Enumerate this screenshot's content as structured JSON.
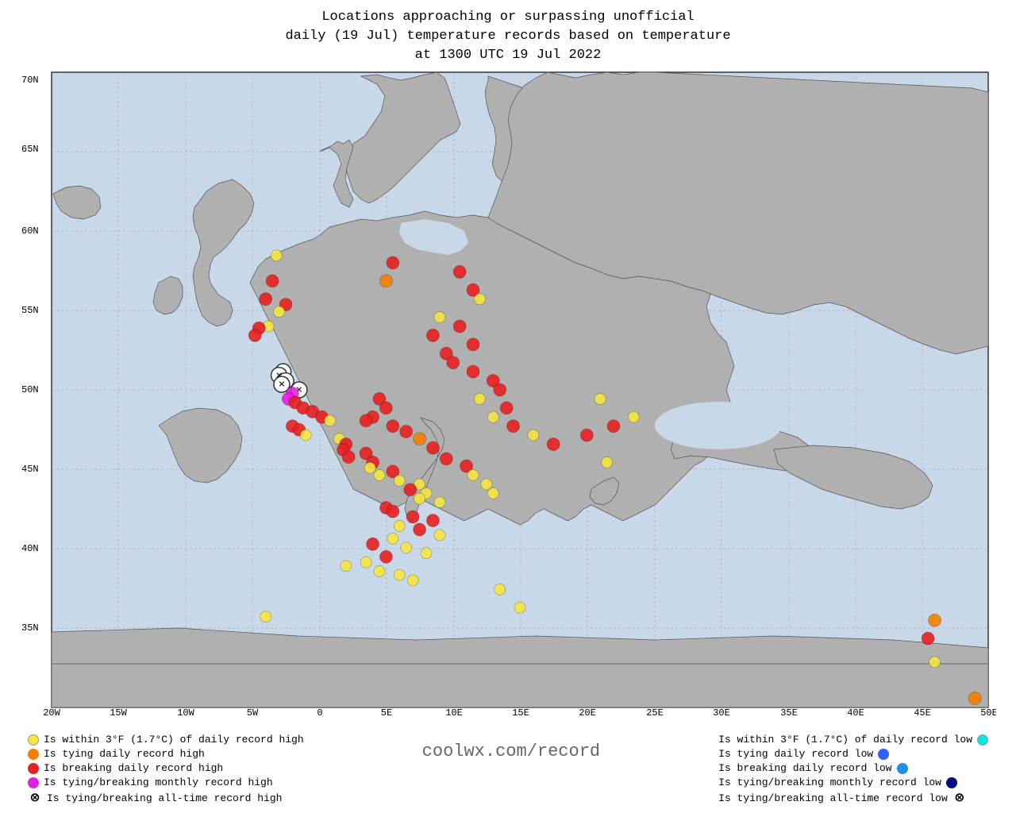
{
  "title": {
    "line1": "Locations approaching or surpassing unofficial",
    "line2": "daily (19 Jul) temperature records based on temperature",
    "line3": "at 1300 UTC 19 Jul 2022"
  },
  "legend": {
    "left": [
      {
        "color": "#f5e642",
        "label": "Is within 3°F (1.7°C) of daily record high",
        "type": "dot"
      },
      {
        "color": "#f58000",
        "label": "Is tying daily record high",
        "type": "dot"
      },
      {
        "color": "#e82020",
        "label": "Is breaking daily record high",
        "type": "dot"
      },
      {
        "color": "#e020e0",
        "label": "Is tying/breaking monthly record high",
        "type": "dot"
      },
      {
        "color": "#000",
        "label": "Is tying/breaking all-time record high",
        "type": "cross"
      }
    ],
    "right": [
      {
        "color": "#00e8e8",
        "label": "Is within 3°F (1.7°C) of daily record low",
        "type": "dot"
      },
      {
        "color": "#3060ff",
        "label": "Is tying daily record low",
        "type": "dot"
      },
      {
        "color": "#2090e0",
        "label": "Is breaking daily record low",
        "type": "dot"
      },
      {
        "color": "#001080",
        "label": "Is tying/breaking monthly record low",
        "type": "dot"
      },
      {
        "color": "#000",
        "label": "Is tying/breaking all-time record low",
        "type": "cross"
      }
    ],
    "center_text": "coolwx.com/record"
  },
  "map": {
    "lat_labels": [
      "70N",
      "65N",
      "60N",
      "55N",
      "50N",
      "45N",
      "40N",
      "35N"
    ],
    "lon_labels": [
      "20W",
      "15W",
      "10W",
      "5W",
      "0",
      "5E",
      "10E",
      "15E",
      "20E",
      "25E",
      "30E",
      "35E",
      "40E",
      "45E",
      "50E"
    ]
  },
  "data_points": [
    {
      "lat": 59.9,
      "lon": -3.2,
      "color": "#f5e642",
      "r": 7
    },
    {
      "lat": 58.5,
      "lon": -3.5,
      "color": "#e82020",
      "r": 8
    },
    {
      "lat": 57.5,
      "lon": -4.0,
      "color": "#e82020",
      "r": 8
    },
    {
      "lat": 57.2,
      "lon": -2.5,
      "color": "#e82020",
      "r": 8
    },
    {
      "lat": 56.8,
      "lon": -3.0,
      "color": "#f5e642",
      "r": 7
    },
    {
      "lat": 56.0,
      "lon": -3.8,
      "color": "#f5e642",
      "r": 7
    },
    {
      "lat": 55.9,
      "lon": -4.5,
      "color": "#e82020",
      "r": 8
    },
    {
      "lat": 55.5,
      "lon": -4.8,
      "color": "#e82020",
      "r": 8
    },
    {
      "lat": 53.5,
      "lon": -2.7,
      "color": "#000",
      "r": 9,
      "cross": true
    },
    {
      "lat": 53.3,
      "lon": -3.0,
      "color": "#000",
      "r": 9,
      "cross": true
    },
    {
      "lat": 53.0,
      "lon": -2.5,
      "color": "#000",
      "r": 9,
      "cross": true
    },
    {
      "lat": 52.8,
      "lon": -2.8,
      "color": "#000",
      "r": 9,
      "cross": true
    },
    {
      "lat": 52.5,
      "lon": -1.5,
      "color": "#000",
      "r": 9,
      "cross": true
    },
    {
      "lat": 52.3,
      "lon": -2.0,
      "color": "#e820e0",
      "r": 8
    },
    {
      "lat": 52.0,
      "lon": -2.3,
      "color": "#e820e0",
      "r": 8
    },
    {
      "lat": 51.8,
      "lon": -1.8,
      "color": "#e82020",
      "r": 8
    },
    {
      "lat": 51.5,
      "lon": -1.2,
      "color": "#e82020",
      "r": 8
    },
    {
      "lat": 51.3,
      "lon": -0.5,
      "color": "#e82020",
      "r": 8
    },
    {
      "lat": 51.0,
      "lon": 0.2,
      "color": "#e82020",
      "r": 8
    },
    {
      "lat": 50.8,
      "lon": 0.8,
      "color": "#f5e642",
      "r": 7
    },
    {
      "lat": 50.5,
      "lon": -2.0,
      "color": "#e82020",
      "r": 8
    },
    {
      "lat": 50.3,
      "lon": -1.5,
      "color": "#e82020",
      "r": 8
    },
    {
      "lat": 50.0,
      "lon": -1.0,
      "color": "#f5e642",
      "r": 7
    },
    {
      "lat": 49.8,
      "lon": 1.5,
      "color": "#f5e642",
      "r": 7
    },
    {
      "lat": 49.5,
      "lon": 2.0,
      "color": "#e82020",
      "r": 8
    },
    {
      "lat": 49.2,
      "lon": 1.8,
      "color": "#e82020",
      "r": 8
    },
    {
      "lat": 49.0,
      "lon": 3.5,
      "color": "#e82020",
      "r": 8
    },
    {
      "lat": 48.8,
      "lon": 2.2,
      "color": "#e82020",
      "r": 8
    },
    {
      "lat": 48.5,
      "lon": 4.0,
      "color": "#e82020",
      "r": 8
    },
    {
      "lat": 48.2,
      "lon": 3.8,
      "color": "#f5e642",
      "r": 7
    },
    {
      "lat": 48.0,
      "lon": 5.5,
      "color": "#e82020",
      "r": 8
    },
    {
      "lat": 47.8,
      "lon": 4.5,
      "color": "#f5e642",
      "r": 7
    },
    {
      "lat": 47.5,
      "lon": 6.0,
      "color": "#f5e642",
      "r": 7
    },
    {
      "lat": 47.3,
      "lon": 7.5,
      "color": "#f5e642",
      "r": 7
    },
    {
      "lat": 47.0,
      "lon": 6.8,
      "color": "#e82020",
      "r": 8
    },
    {
      "lat": 46.8,
      "lon": 8.0,
      "color": "#f5e642",
      "r": 7
    },
    {
      "lat": 46.5,
      "lon": 7.5,
      "color": "#f5e642",
      "r": 7
    },
    {
      "lat": 46.3,
      "lon": 9.0,
      "color": "#f5e642",
      "r": 7
    },
    {
      "lat": 46.0,
      "lon": 5.0,
      "color": "#e82020",
      "r": 8
    },
    {
      "lat": 45.8,
      "lon": 5.5,
      "color": "#e82020",
      "r": 8
    },
    {
      "lat": 45.5,
      "lon": 7.0,
      "color": "#e82020",
      "r": 8
    },
    {
      "lat": 45.3,
      "lon": 8.5,
      "color": "#e82020",
      "r": 8
    },
    {
      "lat": 45.0,
      "lon": 6.0,
      "color": "#f5e642",
      "r": 7
    },
    {
      "lat": 44.8,
      "lon": 7.5,
      "color": "#e82020",
      "r": 8
    },
    {
      "lat": 44.5,
      "lon": 9.0,
      "color": "#f5e642",
      "r": 7
    },
    {
      "lat": 44.3,
      "lon": 5.5,
      "color": "#f5e642",
      "r": 7
    },
    {
      "lat": 44.0,
      "lon": 4.0,
      "color": "#e82020",
      "r": 8
    },
    {
      "lat": 43.8,
      "lon": 6.5,
      "color": "#f5e642",
      "r": 7
    },
    {
      "lat": 43.5,
      "lon": 8.0,
      "color": "#f5e642",
      "r": 7
    },
    {
      "lat": 43.3,
      "lon": 5.0,
      "color": "#e82020",
      "r": 8
    },
    {
      "lat": 43.0,
      "lon": 3.5,
      "color": "#f5e642",
      "r": 7
    },
    {
      "lat": 42.8,
      "lon": 2.0,
      "color": "#f5e642",
      "r": 7
    },
    {
      "lat": 42.5,
      "lon": 4.5,
      "color": "#f5e642",
      "r": 7
    },
    {
      "lat": 42.3,
      "lon": 6.0,
      "color": "#f5e642",
      "r": 7
    },
    {
      "lat": 42.0,
      "lon": 7.0,
      "color": "#f5e642",
      "r": 7
    },
    {
      "lat": 41.5,
      "lon": 13.5,
      "color": "#f5e642",
      "r": 7
    },
    {
      "lat": 40.5,
      "lon": 15.0,
      "color": "#f5e642",
      "r": 7
    },
    {
      "lat": 40.0,
      "lon": -4.0,
      "color": "#f5e642",
      "r": 7
    },
    {
      "lat": 39.8,
      "lon": 46.0,
      "color": "#f58000",
      "r": 8
    },
    {
      "lat": 38.8,
      "lon": 45.5,
      "color": "#e82020",
      "r": 8
    },
    {
      "lat": 37.5,
      "lon": 46.0,
      "color": "#f5e642",
      "r": 7
    },
    {
      "lat": 35.5,
      "lon": 49.0,
      "color": "#f58000",
      "r": 8
    },
    {
      "lat": 59.5,
      "lon": 5.5,
      "color": "#e82020",
      "r": 8
    },
    {
      "lat": 59.0,
      "lon": 10.5,
      "color": "#e82020",
      "r": 8
    },
    {
      "lat": 58.5,
      "lon": 5.0,
      "color": "#f58000",
      "r": 8
    },
    {
      "lat": 58.0,
      "lon": 11.5,
      "color": "#e82020",
      "r": 8
    },
    {
      "lat": 57.5,
      "lon": 12.0,
      "color": "#f5e642",
      "r": 7
    },
    {
      "lat": 56.5,
      "lon": 9.0,
      "color": "#f5e642",
      "r": 7
    },
    {
      "lat": 56.0,
      "lon": 10.5,
      "color": "#e82020",
      "r": 8
    },
    {
      "lat": 55.5,
      "lon": 8.5,
      "color": "#e82020",
      "r": 8
    },
    {
      "lat": 55.0,
      "lon": 11.5,
      "color": "#e82020",
      "r": 8
    },
    {
      "lat": 54.5,
      "lon": 9.5,
      "color": "#e82020",
      "r": 8
    },
    {
      "lat": 54.0,
      "lon": 10.0,
      "color": "#e82020",
      "r": 8
    },
    {
      "lat": 53.5,
      "lon": 11.5,
      "color": "#e82020",
      "r": 8
    },
    {
      "lat": 53.0,
      "lon": 13.0,
      "color": "#e82020",
      "r": 8
    },
    {
      "lat": 52.5,
      "lon": 13.5,
      "color": "#e82020",
      "r": 8
    },
    {
      "lat": 52.0,
      "lon": 12.0,
      "color": "#f5e642",
      "r": 7
    },
    {
      "lat": 51.5,
      "lon": 14.0,
      "color": "#e82020",
      "r": 8
    },
    {
      "lat": 51.0,
      "lon": 13.0,
      "color": "#f5e642",
      "r": 7
    },
    {
      "lat": 50.5,
      "lon": 14.5,
      "color": "#e82020",
      "r": 8
    },
    {
      "lat": 50.0,
      "lon": 16.0,
      "color": "#f5e642",
      "r": 7
    },
    {
      "lat": 49.5,
      "lon": 17.5,
      "color": "#e82020",
      "r": 8
    },
    {
      "lat": 52.0,
      "lon": 4.5,
      "color": "#e82020",
      "r": 8
    },
    {
      "lat": 51.5,
      "lon": 5.0,
      "color": "#e82020",
      "r": 8
    },
    {
      "lat": 51.0,
      "lon": 4.0,
      "color": "#e82020",
      "r": 8
    },
    {
      "lat": 50.8,
      "lon": 3.5,
      "color": "#e82020",
      "r": 8
    },
    {
      "lat": 50.5,
      "lon": 5.5,
      "color": "#e82020",
      "r": 8
    },
    {
      "lat": 50.2,
      "lon": 6.5,
      "color": "#e82020",
      "r": 8
    },
    {
      "lat": 49.8,
      "lon": 7.5,
      "color": "#f58000",
      "r": 8
    },
    {
      "lat": 49.3,
      "lon": 8.5,
      "color": "#e82020",
      "r": 8
    },
    {
      "lat": 48.7,
      "lon": 9.5,
      "color": "#e82020",
      "r": 8
    },
    {
      "lat": 48.3,
      "lon": 11.0,
      "color": "#e82020",
      "r": 8
    },
    {
      "lat": 47.8,
      "lon": 11.5,
      "color": "#f5e642",
      "r": 7
    },
    {
      "lat": 47.3,
      "lon": 12.5,
      "color": "#f5e642",
      "r": 7
    },
    {
      "lat": 46.8,
      "lon": 13.0,
      "color": "#f5e642",
      "r": 7
    },
    {
      "lat": 50.0,
      "lon": 20.0,
      "color": "#e82020",
      "r": 8
    },
    {
      "lat": 50.5,
      "lon": 22.0,
      "color": "#e82020",
      "r": 8
    },
    {
      "lat": 51.0,
      "lon": 23.5,
      "color": "#f5e642",
      "r": 7
    },
    {
      "lat": 52.0,
      "lon": 21.0,
      "color": "#f5e642",
      "r": 7
    },
    {
      "lat": 48.5,
      "lon": 21.5,
      "color": "#f5e642",
      "r": 7
    }
  ]
}
